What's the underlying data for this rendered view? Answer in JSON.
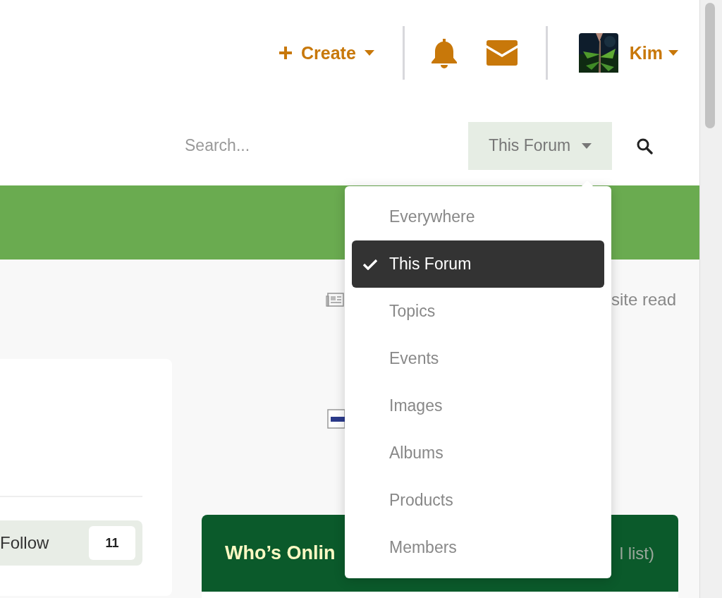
{
  "header": {
    "create_button": {
      "label": "Create"
    },
    "user": {
      "name": "Kim"
    }
  },
  "search": {
    "placeholder": "Search...",
    "scope_button": {
      "label": "This Forum"
    }
  },
  "scope_menu": {
    "items": [
      {
        "label": "Everywhere",
        "selected": false
      },
      {
        "label": "This Forum",
        "selected": true
      },
      {
        "label": "Topics",
        "selected": false
      },
      {
        "label": "Events",
        "selected": false
      },
      {
        "label": "Images",
        "selected": false
      },
      {
        "label": "Albums",
        "selected": false
      },
      {
        "label": "Products",
        "selected": false
      },
      {
        "label": "Members",
        "selected": false
      }
    ]
  },
  "mark_read": {
    "label": "site read"
  },
  "follow": {
    "label": "Follow",
    "count": "11"
  },
  "whos_online": {
    "title": "Who’s Onlin",
    "link": "l list)"
  }
}
